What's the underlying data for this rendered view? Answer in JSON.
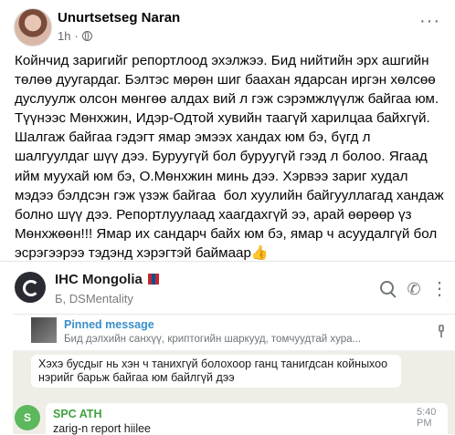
{
  "post": {
    "author": "Unurtsetseg Naran",
    "time": "1h",
    "separator": "·",
    "more": "···",
    "text": "Койнчид заригийг репортлоод эхэлжээ. Бид нийтийн эрх ашгийн төлөө дуугардаг. Бэлтэс мөрөн шиг баахан ядарсан иргэн хөлсөө дуслуулж олсон мөнгөө алдах вий л гэж сэрэмжлүүлж байгаа юм. Түүнээс Мөнхжин, Идэр-Одтой хувийн таагүй харилцаа байхгүй. Шалгаж байгаа гэдэгт ямар эмээх хандах юм бэ, бүгд л шалгуулдаг шүү дээ. Буруугүй бол буруугүй гээд л болоо. Ягаад ийм муухай юм бэ, О.Мөнхжин минь дээ. Хэрвээ зариг худал мэдээ бэлдсэн гэж үзэж байгаа  бол хуулийн байгууллагад хандаж болно шүү дээ. Репортлуулаад хаагдахгүй ээ, арай өөрөөр үз Мөнхжөөн!!! Ямар их сандарч байх юм бэ, ямар ч асуудалгүй бол эсрэгээрээ тэдэнд хэрэгтэй баймаар👍"
  },
  "telegram": {
    "channel_title": "IHC Mongolia",
    "subtitle": "Б, DSMentality",
    "phone_glyph": "✆",
    "menu_glyph": "⋮",
    "pinned_label": "Pinned message",
    "pinned_text": "Бид дэлхийн санхүү, криптогийн шаркууд, томчуудтай хура...",
    "message1": "Хэхэ бусдыг нь хэн ч танихгүй болохоор ганц танигдсан койныхоо нэрийг барьж байгаа юм байлгүй дээ",
    "message2_avatar": "S",
    "message2_sender": "SPC ATH",
    "message2_text": "zarig-n report hiilee",
    "message2_time": "5:40 PM"
  }
}
